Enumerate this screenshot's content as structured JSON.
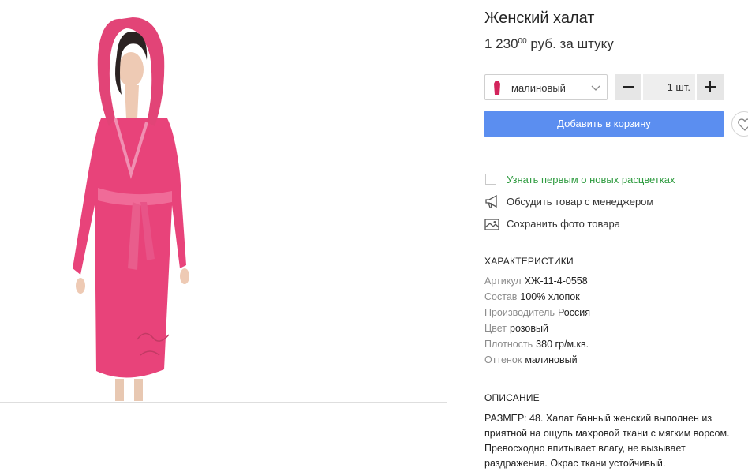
{
  "product": {
    "title": "Женский халат",
    "price_main": "1 230",
    "price_cents": "00",
    "price_unit": " руб. за штуку"
  },
  "color_select": {
    "selected": "малиновый",
    "swatch_color": "#d3245c"
  },
  "quantity": {
    "value": "1 шт."
  },
  "add_to_cart_label": "Добавить в корзину",
  "actions": {
    "notify_new_colors": "Узнать первым о новых расцветках",
    "discuss_with_manager": "Обсудить товар с менеджером",
    "save_photo": "Сохранить фото товара"
  },
  "characteristics": {
    "title": "ХАРАКТЕРИСТИКИ",
    "items": [
      {
        "key": "Артикул",
        "value": "ХЖ-11-4-0558"
      },
      {
        "key": "Состав",
        "value": "100% хлопок"
      },
      {
        "key": "Производитель",
        "value": "Россия"
      },
      {
        "key": "Цвет",
        "value": "розовый"
      },
      {
        "key": "Плотность",
        "value": "380 гр/м.кв."
      },
      {
        "key": "Оттенок",
        "value": "малиновый"
      }
    ]
  },
  "description": {
    "title": "ОПИСАНИЕ",
    "text": "РАЗМЕР: 48. Халат банный женский выполнен из приятной на ощупь махровой ткани с мягким ворсом. Превосходно впитывает влагу, не вызывает раздражения. Окрас ткани устойчивый."
  },
  "colors": {
    "accent_button": "#5b8ef0",
    "link_green": "#2e9b3f",
    "robe": "#e8437a"
  }
}
